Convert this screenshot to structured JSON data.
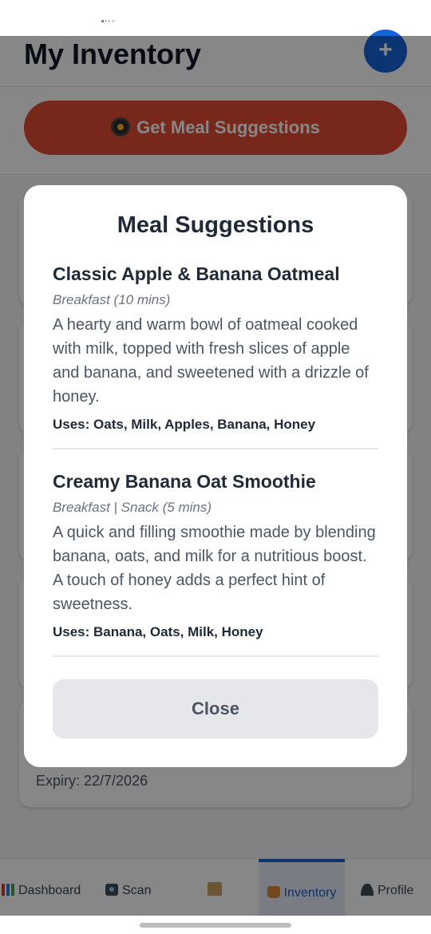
{
  "status_bar": {
    "mini_text": "■ ▪ ◐ ✓"
  },
  "header": {
    "title": "My Inventory",
    "add_button_label": "+"
  },
  "suggest_button": {
    "label": "Get Meal Suggestions",
    "icon": "frying-pan-icon"
  },
  "inventory": {
    "last_item_expiry": "Expiry: 22/7/2026"
  },
  "bottom_nav": {
    "items": [
      {
        "label": "Dashboard",
        "icon": "bar-chart-icon"
      },
      {
        "label": "Scan",
        "icon": "camera-icon"
      },
      {
        "label": "",
        "icon": "scroll-icon"
      },
      {
        "label": "Inventory",
        "icon": "jar-icon",
        "active": true
      },
      {
        "label": "Profile",
        "icon": "person-icon"
      }
    ]
  },
  "modal": {
    "title": "Meal Suggestions",
    "meals": [
      {
        "name": "Classic Apple & Banana Oatmeal",
        "category": "Breakfast (10 mins)",
        "description": "A hearty and warm bowl of oatmeal cooked with milk, topped with fresh slices of apple and banana, and sweetened with a drizzle of honey.",
        "uses": "Uses: Oats, Milk, Apples, Banana, Honey"
      },
      {
        "name": "Creamy Banana Oat Smoothie",
        "category": "Breakfast | Snack (5 mins)",
        "description": "A quick and filling smoothie made by blending banana, oats, and milk for a nutritious boost. A touch of honey adds a perfect hint of sweetness.",
        "uses": "Uses: Banana, Oats, Milk, Honey"
      }
    ],
    "close_label": "Close"
  },
  "colors": {
    "accent_blue": "#1565d8",
    "suggest_red": "#e24c32",
    "active_nav": "#1d5fc7"
  }
}
